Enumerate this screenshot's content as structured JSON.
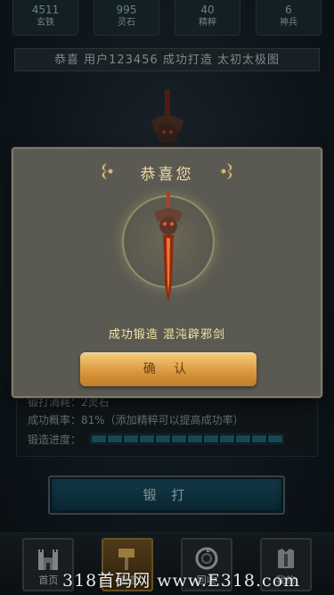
{
  "stats": [
    {
      "value": "4511",
      "label": "玄铁"
    },
    {
      "value": "995",
      "label": "灵石"
    },
    {
      "value": "40",
      "label": "精粹"
    },
    {
      "value": "6",
      "label": "神兵"
    }
  ],
  "announcement": "恭喜 用户123456 成功打造 太初太极图",
  "info": {
    "cost_line": "锻打消耗：2灵石",
    "rate_line": "成功概率：81%（添加精粹可以提高成功率）",
    "progress_label": "锻造进度：",
    "progress_fraction": 1.0
  },
  "forge_button": "锻 打",
  "modal": {
    "title": "恭喜您",
    "message": "成功锻造 混沌辟邪剑",
    "confirm": "确 认"
  },
  "nav": [
    {
      "label": "首页",
      "icon": "castle-icon"
    },
    {
      "label": "锻造",
      "icon": "hammer-icon"
    },
    {
      "label": "回收",
      "icon": "recycle-icon"
    },
    {
      "label": "我的",
      "icon": "armor-icon"
    }
  ],
  "watermark": "318首码网 www.E318.com",
  "colors": {
    "accent_gold": "#f0dca2",
    "progress_fill": "#1f6f80",
    "confirm_button": "#d9953a"
  }
}
